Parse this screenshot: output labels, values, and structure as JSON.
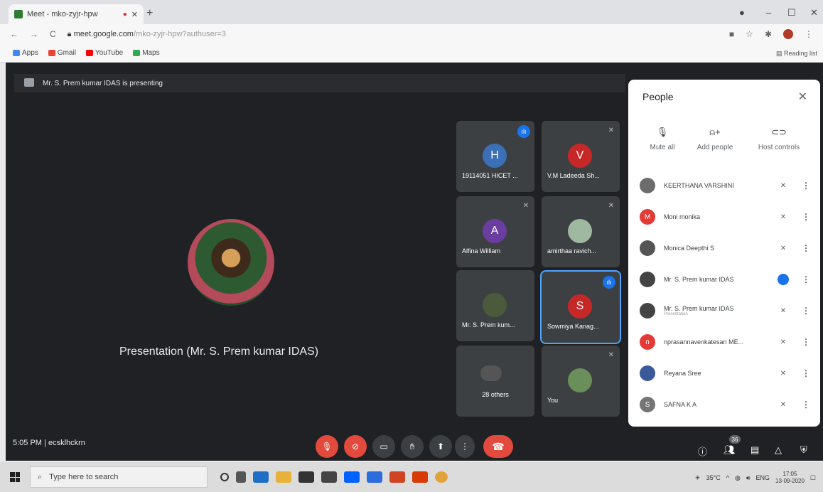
{
  "browser": {
    "tab_title": "Meet - mko-zyjr-hpw",
    "tab_recording": "●",
    "tab_close": "✕",
    "new_tab": "+",
    "win_min": "–",
    "win_max": "☐",
    "win_close": "✕",
    "url_main": "meet.google.com",
    "url_rest": "/mko-zyjr-hpw?authuser=3",
    "bookmarks": [
      "Apps",
      "Gmail",
      "YouTube",
      "Maps"
    ],
    "reading_list": "Reading list"
  },
  "meet": {
    "presenting_banner": "Mr. S. Prem kumar IDAS is presenting",
    "main_caption": "Presentation (Mr. S. Prem kumar IDAS)",
    "time": "5:05 PM",
    "separator": "|",
    "meeting_code": "ecsklhckrn",
    "people_count": "36",
    "tiles": [
      {
        "initial": "H",
        "name": "19114051 HICET ...",
        "color": "#3b6fb6"
      },
      {
        "initial": "V",
        "name": "V.M Ladeeda Sh...",
        "color": "#c62828"
      },
      {
        "initial": "A",
        "name": "Alfina William",
        "color": "#6a3ea1"
      },
      {
        "initial": "",
        "name": "amirthaa ravich...",
        "color": "#9fb8a0"
      },
      {
        "initial": "",
        "name": "Mr. S. Prem kum...",
        "color": "#4a5a3a"
      },
      {
        "initial": "S",
        "name": "Sowmiya Kanag...",
        "color": "#c62828"
      },
      {
        "initial": "",
        "name": "28 others",
        "color": "#555"
      },
      {
        "initial": "",
        "name": "You",
        "color": "#6a8f5a"
      }
    ]
  },
  "people_panel": {
    "title": "People",
    "close": "✕",
    "actions": [
      {
        "label": "Mute all",
        "icon": "mic-off-icon"
      },
      {
        "label": "Add people",
        "icon": "add-person-icon"
      },
      {
        "label": "Host controls",
        "icon": "toggle-icon"
      }
    ],
    "participants": [
      {
        "initial": "",
        "name": "KEERTHANA VARSHINI",
        "sub": "",
        "color": "#6d6d6d"
      },
      {
        "initial": "M",
        "name": "Moni monika",
        "sub": "",
        "color": "#e53935"
      },
      {
        "initial": "",
        "name": "Monica Deepthi S",
        "sub": "",
        "color": "#555"
      },
      {
        "initial": "",
        "name": "Mr. S. Prem kumar IDAS",
        "sub": "",
        "color": "#444"
      },
      {
        "initial": "",
        "name": "Mr. S. Prem kumar IDAS",
        "sub": "Presentation",
        "color": "#444"
      },
      {
        "initial": "n",
        "name": "nprasannavenkatesan ME...",
        "sub": "",
        "color": "#e53935"
      },
      {
        "initial": "",
        "name": "Reyana Sree",
        "sub": "",
        "color": "#3b5998"
      },
      {
        "initial": "S",
        "name": "SAFNA K A",
        "sub": "",
        "color": "#757575"
      }
    ]
  },
  "taskbar": {
    "search_placeholder": "Type here to search",
    "temperature": "35°C",
    "language": "ENG",
    "time": "17:05",
    "date": "13-09-2020"
  }
}
